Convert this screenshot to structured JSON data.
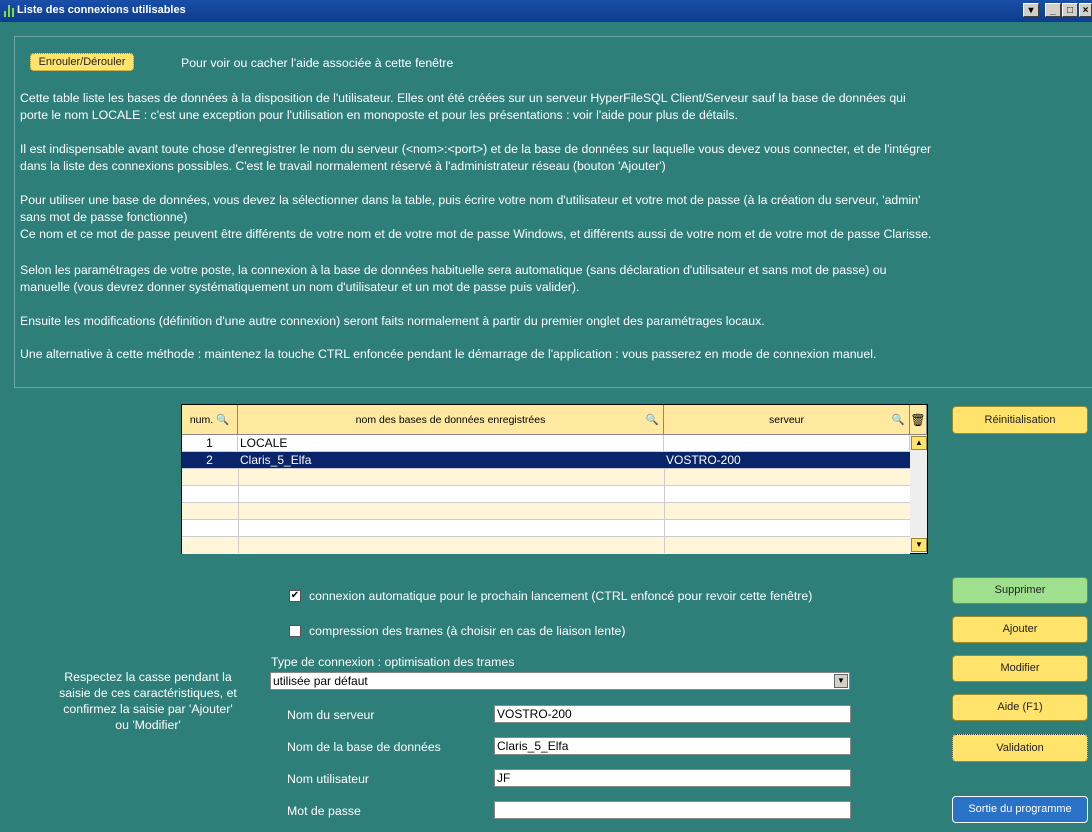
{
  "window": {
    "title": "Liste des connexions utilisables"
  },
  "help": {
    "toggle_label": "Enrouler/Dérouler",
    "toggle_caption": "Pour voir ou cacher l'aide associée à cette fenêtre",
    "p1a": "Cette table liste les bases de données à la disposition de l'utilisateur. Elles ont été créées sur un serveur HyperFileSQL Client/Serveur sauf la base de données qui",
    "p1b": "porte le nom LOCALE : c'est une exception pour l'utilisation en monoposte et pour les présentations :  voir l'aide pour plus de détails.",
    "p2a": "Il est indispensable avant toute chose d'enregistrer le nom du serveur (<nom>:<port>) et de la base de données sur laquelle vous devez vous connecter, et de l'intégrer",
    "p2b": "dans la liste des connexions possibles. C'est le travail normalement réservé à l'administrateur réseau (bouton 'Ajouter')",
    "p3a": "Pour utiliser une base de données, vous devez la sélectionner dans la table, puis écrire votre nom d'utilisateur et votre mot de passe (à la création du serveur, 'admin'",
    "p3b": "sans mot de passe fonctionne)",
    "p3c": "Ce nom et ce mot de passe peuvent être différents de votre nom et de votre mot de passe Windows, et différents aussi de votre nom et de votre mot de passe Clarisse.",
    "p4a": "Selon les paramétrages de votre poste, la connexion à la base de données habituelle sera automatique (sans déclaration d'utilisateur et sans mot de passe) ou",
    "p4b": "manuelle (vous devrez donner systématiquement un nom d'utilisateur et un mot de passe puis valider).",
    "p5": "Ensuite les modifications (définition d'une autre connexion) seront faits normalement à partir du premier onglet des paramétrages locaux.",
    "p6": "Une alternative à cette méthode : maintenez la touche CTRL enfoncée pendant le démarrage de l'application : vous passerez en mode de connexion manuel."
  },
  "table": {
    "headers": [
      "num.",
      "nom des bases de données enregistrées",
      "serveur"
    ],
    "rows": [
      {
        "num": "1",
        "name": "LOCALE",
        "server": ""
      },
      {
        "num": "2",
        "name": "Claris_5_Elfa",
        "server": "VOSTRO-200"
      }
    ]
  },
  "options": {
    "auto_connect_label": "connexion automatique pour le prochain lancement (CTRL enfoncé pour revoir cette fenêtre)",
    "auto_connect_checked": true,
    "compression_label": "compression des trames (à choisir en cas de liaison lente)",
    "compression_checked": false,
    "connection_type_label": "Type de connexion : optimisation des trames",
    "connection_type_value": "utilisée par défaut"
  },
  "form": {
    "server_label": "Nom du serveur",
    "server_value": "VOSTRO-200",
    "db_label": "Nom de la base de données",
    "db_value": "Claris_5_Elfa",
    "user_label": "Nom utilisateur",
    "user_value": "JF",
    "password_label": "Mot de passe",
    "password_value": ""
  },
  "note": {
    "l1": "Respectez la casse pendant la",
    "l2": "saisie de ces caractéristiques, et",
    "l3": "confirmez la saisie par 'Ajouter'",
    "l4": "ou 'Modifier'"
  },
  "buttons": {
    "reset": "Réinitialisation",
    "delete": "Supprimer",
    "add": "Ajouter",
    "edit": "Modifier",
    "help": "Aide (F1)",
    "validate": "Validation",
    "exit": "Sortie du programme"
  },
  "colors": {
    "background": "#2E7F7A",
    "button_yellow": "#FFE36B",
    "button_green": "#9EE08E",
    "button_blue": "#2A72C8",
    "selection": "#0A246A"
  }
}
